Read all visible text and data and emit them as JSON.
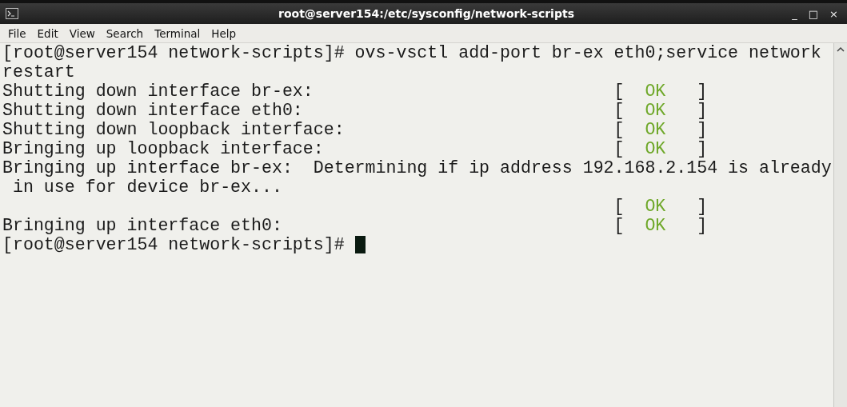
{
  "window": {
    "title": "root@server154:/etc/sysconfig/network-scripts",
    "controls": [
      "_",
      "□",
      "×"
    ]
  },
  "menu": [
    "File",
    "Edit",
    "View",
    "Search",
    "Terminal",
    "Help"
  ],
  "terminal": {
    "lines": [
      {
        "text": "[root@server154 network-scripts]# ovs-vsctl add-port br-ex eth0;service network"
      },
      {
        "text": "restart"
      },
      {
        "text": "Shutting down interface br-ex:",
        "status": {
          "open": "[",
          "label": "OK",
          "close": "]"
        }
      },
      {
        "text": "Shutting down interface eth0:",
        "status": {
          "open": "[",
          "label": "OK",
          "close": "]"
        }
      },
      {
        "text": "Shutting down loopback interface:",
        "status": {
          "open": "[",
          "label": "OK",
          "close": "]"
        }
      },
      {
        "text": "Bringing up loopback interface:",
        "status": {
          "open": "[",
          "label": "OK",
          "close": "]"
        }
      },
      {
        "text": "Bringing up interface br-ex:  Determining if ip address 192.168.2.154 is already"
      },
      {
        "text": " in use for device br-ex..."
      },
      {
        "status": {
          "open": "[",
          "label": "OK",
          "close": "]"
        }
      },
      {
        "text": "Bringing up interface eth0:",
        "status": {
          "open": "[",
          "label": "OK",
          "close": "]"
        }
      },
      {
        "text": "[root@server154 network-scripts]# ",
        "cursor": true
      }
    ]
  }
}
